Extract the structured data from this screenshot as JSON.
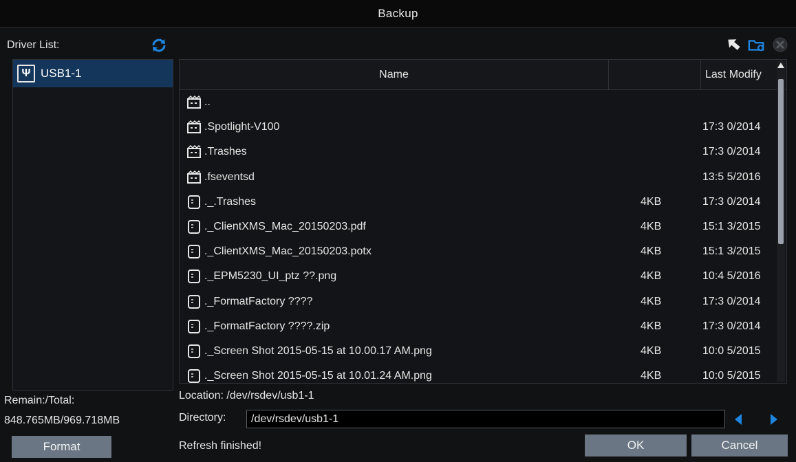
{
  "window": {
    "title": "Backup"
  },
  "driver_list": {
    "label": "Driver List:",
    "items": [
      {
        "name": "USB1-1",
        "icon": "usb-icon",
        "selected": true
      }
    ]
  },
  "toolbar": {
    "icons": [
      "back-arrow-icon",
      "new-folder-icon",
      "delete-icon"
    ]
  },
  "file_table": {
    "columns": {
      "name": "Name",
      "size": "",
      "modified": "Last Modify"
    },
    "rows": [
      {
        "type": "folder",
        "name": "..",
        "size": "",
        "modified": ""
      },
      {
        "type": "folder",
        "name": ".Spotlight-V100",
        "size": "",
        "modified": "0/2014 17:3"
      },
      {
        "type": "folder",
        "name": ".Trashes",
        "size": "",
        "modified": "0/2014 17:3"
      },
      {
        "type": "folder",
        "name": ".fseventsd",
        "size": "",
        "modified": "5/2016 13:5"
      },
      {
        "type": "file",
        "name": "._.Trashes",
        "size": "4KB",
        "modified": "0/2014 17:3"
      },
      {
        "type": "file",
        "name": "._ClientXMS_Mac_20150203.pdf",
        "size": "4KB",
        "modified": "3/2015 15:1"
      },
      {
        "type": "file",
        "name": "._ClientXMS_Mac_20150203.potx",
        "size": "4KB",
        "modified": "3/2015 15:1"
      },
      {
        "type": "file",
        "name": "._EPM5230_UI_ptz ??.png",
        "size": "4KB",
        "modified": "5/2016 10:4"
      },
      {
        "type": "file",
        "name": "._FormatFactory ????",
        "size": "4KB",
        "modified": "0/2014 17:3"
      },
      {
        "type": "file",
        "name": "._FormatFactory ????.zip",
        "size": "4KB",
        "modified": "0/2014 17:3"
      },
      {
        "type": "file",
        "name": "._Screen Shot 2015-05-15 at 10.00.17 AM.png",
        "size": "4KB",
        "modified": "5/2015 10:0"
      },
      {
        "type": "file",
        "name": "._Screen Shot 2015-05-15 at 10.01.24 AM.png",
        "size": "4KB",
        "modified": "5/2015 10:0"
      }
    ]
  },
  "storage": {
    "label": "Remain:/Total:",
    "value": "848.765MB/969.718MB"
  },
  "location": {
    "text": "Location: /dev/rsdev/usb1-1"
  },
  "directory": {
    "label": "Directory:",
    "value": "/dev/rsdev/usb1-1"
  },
  "status": {
    "text": "Refresh finished!"
  },
  "buttons": {
    "format": "Format",
    "ok": "OK",
    "cancel": "Cancel"
  },
  "colors": {
    "accent_blue": "#1e86e0",
    "selected_row": "#14365a",
    "button_bg": "#6a7684"
  }
}
